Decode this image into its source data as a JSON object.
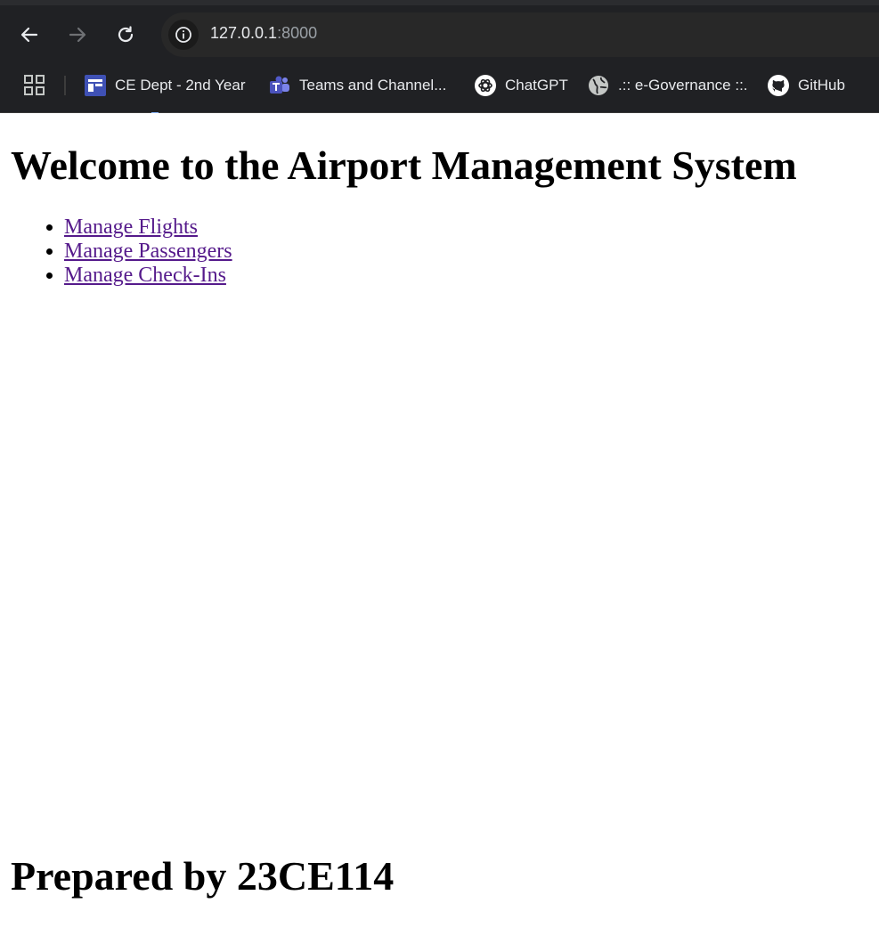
{
  "browser": {
    "url_host": "127.0.0.1",
    "url_port": ":8000",
    "bookmarks": [
      {
        "label": "CE Dept - 2nd Year",
        "icon": "classroom-icon"
      },
      {
        "label": "Teams and Channel...",
        "icon": "teams-icon"
      },
      {
        "label": "ChatGPT",
        "icon": "chatgpt-icon"
      },
      {
        "label": ".:: e-Governance ::.",
        "icon": "globe-icon"
      },
      {
        "label": "GitHub",
        "icon": "github-icon"
      }
    ]
  },
  "page": {
    "heading": "Welcome to the Airport Management System",
    "links": [
      {
        "label": "Manage Flights"
      },
      {
        "label": "Manage Passengers"
      },
      {
        "label": "Manage Check-Ins"
      }
    ],
    "footer": "Prepared by 23CE114"
  },
  "colors": {
    "chrome_bg": "#202124",
    "visited_link": "#551a8b"
  }
}
